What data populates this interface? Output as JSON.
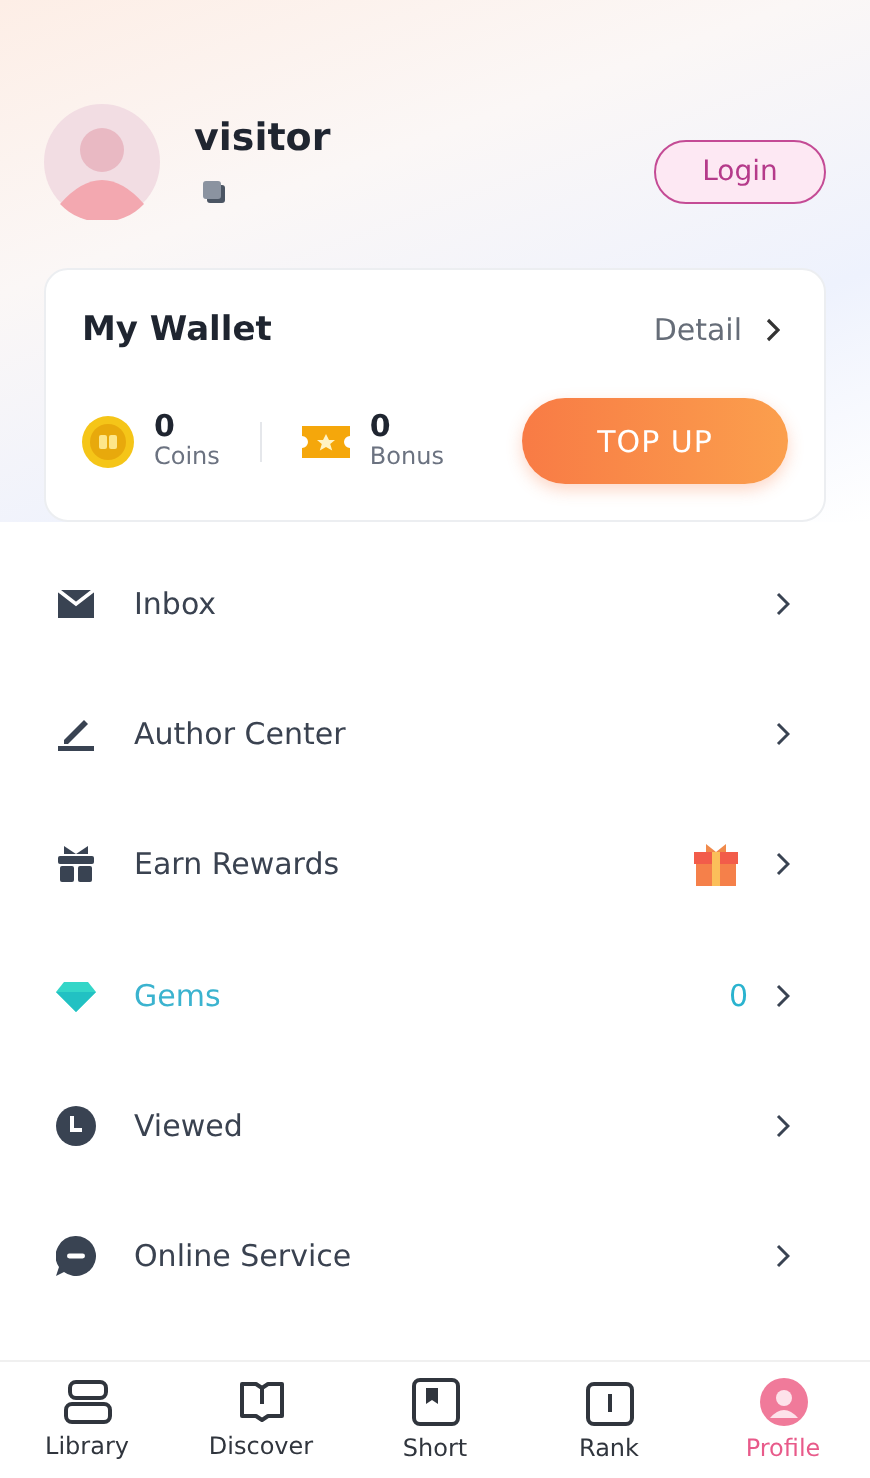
{
  "profile": {
    "name": "visitor",
    "login_button": "Login"
  },
  "wallet": {
    "title": "My Wallet",
    "detail": "Detail",
    "balances": [
      {
        "kind": "coins",
        "amount": "0",
        "label": "Coins"
      },
      {
        "kind": "bonus",
        "amount": "0",
        "label": "Bonus"
      }
    ],
    "top_up": "TOP UP"
  },
  "menu": [
    {
      "kind": "plain",
      "label": "Inbox"
    },
    {
      "kind": "plain",
      "label": "Author Center"
    },
    {
      "kind": "gift",
      "label": "Earn Rewards"
    },
    {
      "kind": "gems",
      "label": "Gems",
      "value": "0"
    },
    {
      "kind": "plain",
      "label": "Viewed"
    },
    {
      "kind": "plain",
      "label": "Online Service"
    }
  ],
  "tabs": [
    {
      "label": "Library",
      "selected": false
    },
    {
      "label": "Discover",
      "selected": false
    },
    {
      "label": "Short",
      "selected": false
    },
    {
      "label": "Rank",
      "selected": false
    },
    {
      "label": "Profile",
      "selected": true
    }
  ]
}
